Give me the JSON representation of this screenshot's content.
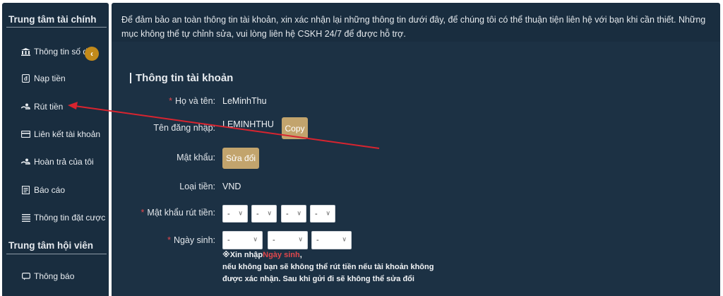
{
  "sidebar": {
    "finance_title": "Trung tâm tài chính",
    "member_title": "Trung tâm hội viên",
    "items": [
      {
        "label": "Thông tin số dư",
        "icon": "bank-icon"
      },
      {
        "label": "Nạp tiền",
        "icon": "deposit-icon"
      },
      {
        "label": "Rút tiền",
        "icon": "withdraw-icon"
      },
      {
        "label": "Liên kết tài khoản",
        "icon": "card-icon"
      },
      {
        "label": "Hoàn trả của tôi",
        "icon": "refund-icon"
      },
      {
        "label": "Báo cáo",
        "icon": "report-icon"
      },
      {
        "label": "Thông tin đặt cược",
        "icon": "list-icon"
      }
    ],
    "member_items": [
      {
        "label": "Thông báo",
        "icon": "message-icon"
      }
    ],
    "collapse_icon": "‹"
  },
  "notice": "Để đảm bảo an toàn thông tin tài khoản, xin xác nhận lại những thông tin dưới đây, để chúng tôi có thể thuận tiện liên hệ với bạn khi cần thiết. Những mục không thể tự chỉnh sửa, vui lòng liên hệ CSKH 24/7 để được hỗ trợ.",
  "account": {
    "title": "Thông tin tài khoản",
    "fullname_label": "Họ và tên:",
    "fullname_value": "LeMinhThu",
    "username_label": "Tên đăng nhập:",
    "username_value": "LEMINHTHU",
    "copy_label": "Copy",
    "password_label": "Mật khẩu:",
    "edit_label": "Sửa đổi",
    "currency_label": "Loại tiền:",
    "currency_value": "VND",
    "withdraw_pw_label": "Mật khẩu rút tiền:",
    "withdraw_pw_selects": [
      "-",
      "-",
      "-",
      "-"
    ],
    "birthday_label": "Ngày sinh:",
    "birthday_selects": [
      "-",
      "-",
      "-"
    ],
    "hint_prefix": "※Xin nhập",
    "hint_highlight": "Ngày sinh",
    "hint_rest": ",\nnếu không bạn sẽ không thể rút tiền nếu tài khoản không được xác nhận. Sau khi gửi đi sẽ không thể sửa đổi"
  },
  "colors": {
    "panel": "#192d3f",
    "accent_gold": "#c2a46d",
    "required_red": "#e0474c",
    "annotation_arrow": "#d8242f"
  }
}
